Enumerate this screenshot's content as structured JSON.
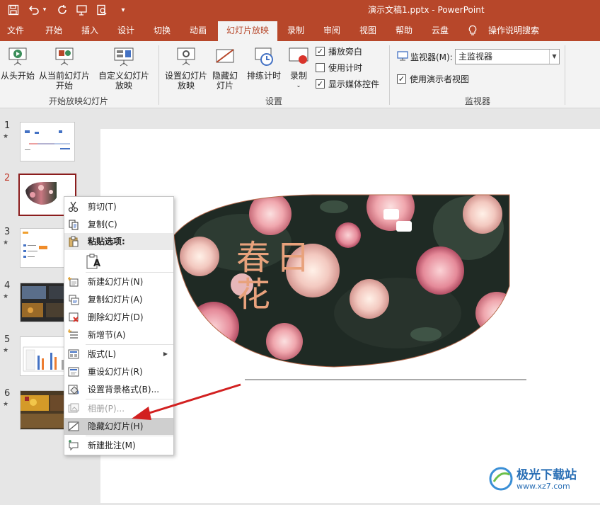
{
  "quick_access": {
    "save_icon": "save-icon",
    "undo_icon": "undo-icon",
    "undo_arrow": "▾",
    "redo_icon": "redo-icon",
    "from_beginning_icon": "present-icon",
    "preview_icon": "preview-icon",
    "customize_icon": "customize-qat-icon"
  },
  "window": {
    "title": "演示文稿1.pptx  -  PowerPoint"
  },
  "tabs": [
    "文件",
    "开始",
    "插入",
    "设计",
    "切换",
    "动画",
    "幻灯片放映",
    "录制",
    "审阅",
    "视图",
    "帮助",
    "云盘"
  ],
  "active_tab": "幻灯片放映",
  "tell_me": "操作说明搜索",
  "ribbon": {
    "from_beginning": "从头开始",
    "from_current": "从当前幻灯片开始",
    "custom_show": "自定义幻灯片放映",
    "group_start": "开始放映幻灯片",
    "setup_show": "设置幻灯片放映",
    "hide_slide": "隐藏幻灯片",
    "rehearse": "排练计时",
    "record": "录制",
    "play_narrations": "播放旁白",
    "use_timings": "使用计时",
    "show_media_controls": "显示媒体控件",
    "group_setup": "设置",
    "monitor_label": "监视器(M):",
    "monitor_value": "主监视器",
    "presenter_view": "使用演示者视图",
    "group_monitors": "监视器"
  },
  "checks": {
    "play_narrations": true,
    "use_timings": false,
    "show_media_controls": true,
    "presenter_view": true
  },
  "slides": [
    {
      "num": "1",
      "star": "★"
    },
    {
      "num": "2",
      "star": ""
    },
    {
      "num": "3",
      "star": "★"
    },
    {
      "num": "4",
      "star": "★"
    },
    {
      "num": "5",
      "star": "★"
    },
    {
      "num": "6",
      "star": "★"
    }
  ],
  "selected_slide": "2",
  "slide_text": {
    "line1a": "春",
    "line1b": "日",
    "line2": "花"
  },
  "context_menu": {
    "cut": "剪切(T)",
    "copy": "复制(C)",
    "paste_options": "粘贴选项:",
    "new_slide": "新建幻灯片(N)",
    "duplicate_slide": "复制幻灯片(A)",
    "delete_slide": "删除幻灯片(D)",
    "add_section": "新增节(A)",
    "layout": "版式(L)",
    "reset_slide": "重设幻灯片(R)",
    "format_background": "设置背景格式(B)...",
    "photo_album": "相册(P)...",
    "hide_slide": "隐藏幻灯片(H)",
    "new_comment": "新建批注(M)",
    "submenu_arrow": "▶",
    "paste_keep_text": "A"
  },
  "watermark": {
    "text": "极光下载站",
    "url": "www.xz7.com"
  },
  "colors": {
    "accent": "#b7472a",
    "selection": "#8b1d1d",
    "slide_text": "#e8a27c",
    "arrow": "#d22020"
  }
}
